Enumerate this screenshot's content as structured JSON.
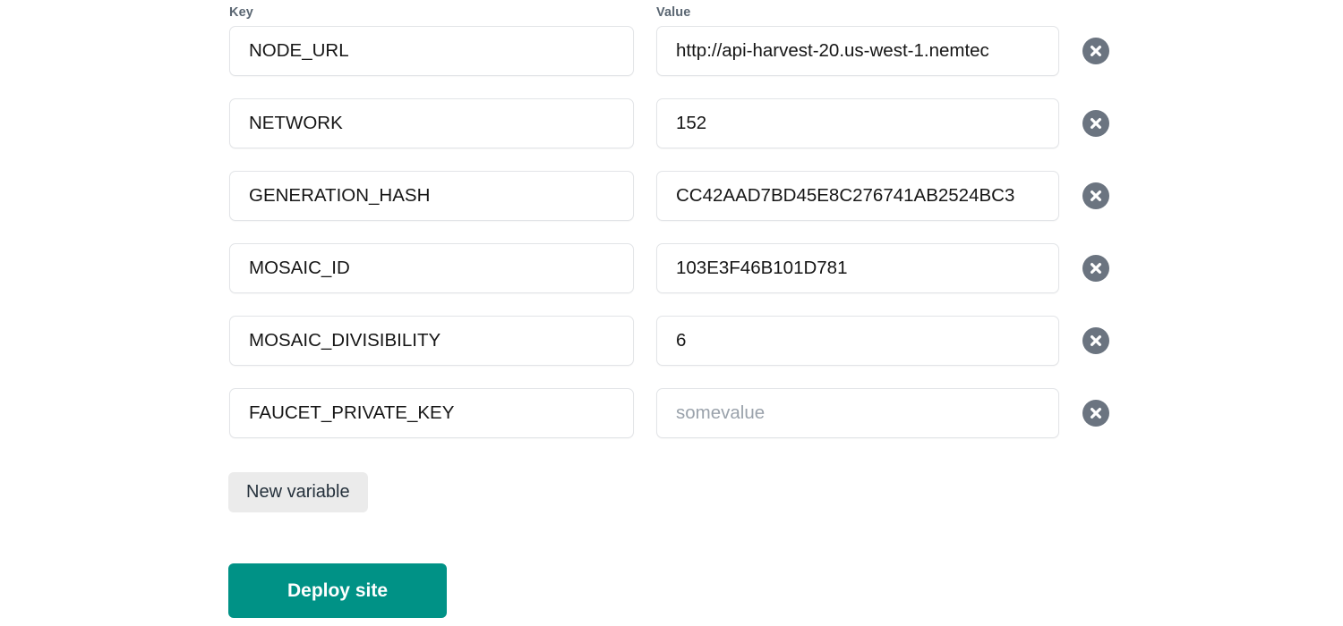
{
  "form": {
    "columns": {
      "key_label": "Key",
      "value_label": "Value"
    },
    "rows": [
      {
        "key": "NODE_URL",
        "value": "http://api-harvest-20.us-west-1.nemtec",
        "value_is_placeholder": false,
        "delete_icon": "close-circle-icon"
      },
      {
        "key": "NETWORK",
        "value": "152",
        "value_is_placeholder": false,
        "delete_icon": "close-circle-icon"
      },
      {
        "key": "GENERATION_HASH",
        "value": "CC42AAD7BD45E8C276741AB2524BC3",
        "value_is_placeholder": false,
        "delete_icon": "close-circle-icon"
      },
      {
        "key": "MOSAIC_ID",
        "value": "103E3F46B101D781",
        "value_is_placeholder": false,
        "delete_icon": "close-circle-icon"
      },
      {
        "key": "MOSAIC_DIVISIBILITY",
        "value": "6",
        "value_is_placeholder": false,
        "delete_icon": "close-circle-icon"
      },
      {
        "key": "FAUCET_PRIVATE_KEY",
        "value": "somevalue",
        "value_is_placeholder": true,
        "delete_icon": "close-circle-icon"
      }
    ],
    "new_variable_label": "New variable",
    "deploy_label": "Deploy site"
  },
  "colors": {
    "deploy_button": "#009286",
    "new_variable_button": "#ebebeb",
    "delete_button": "#6b7480",
    "field_border": "#e2e4e7",
    "header_text": "#5a6672",
    "placeholder_text": "#9aa2ab",
    "background": "#ffffff"
  }
}
